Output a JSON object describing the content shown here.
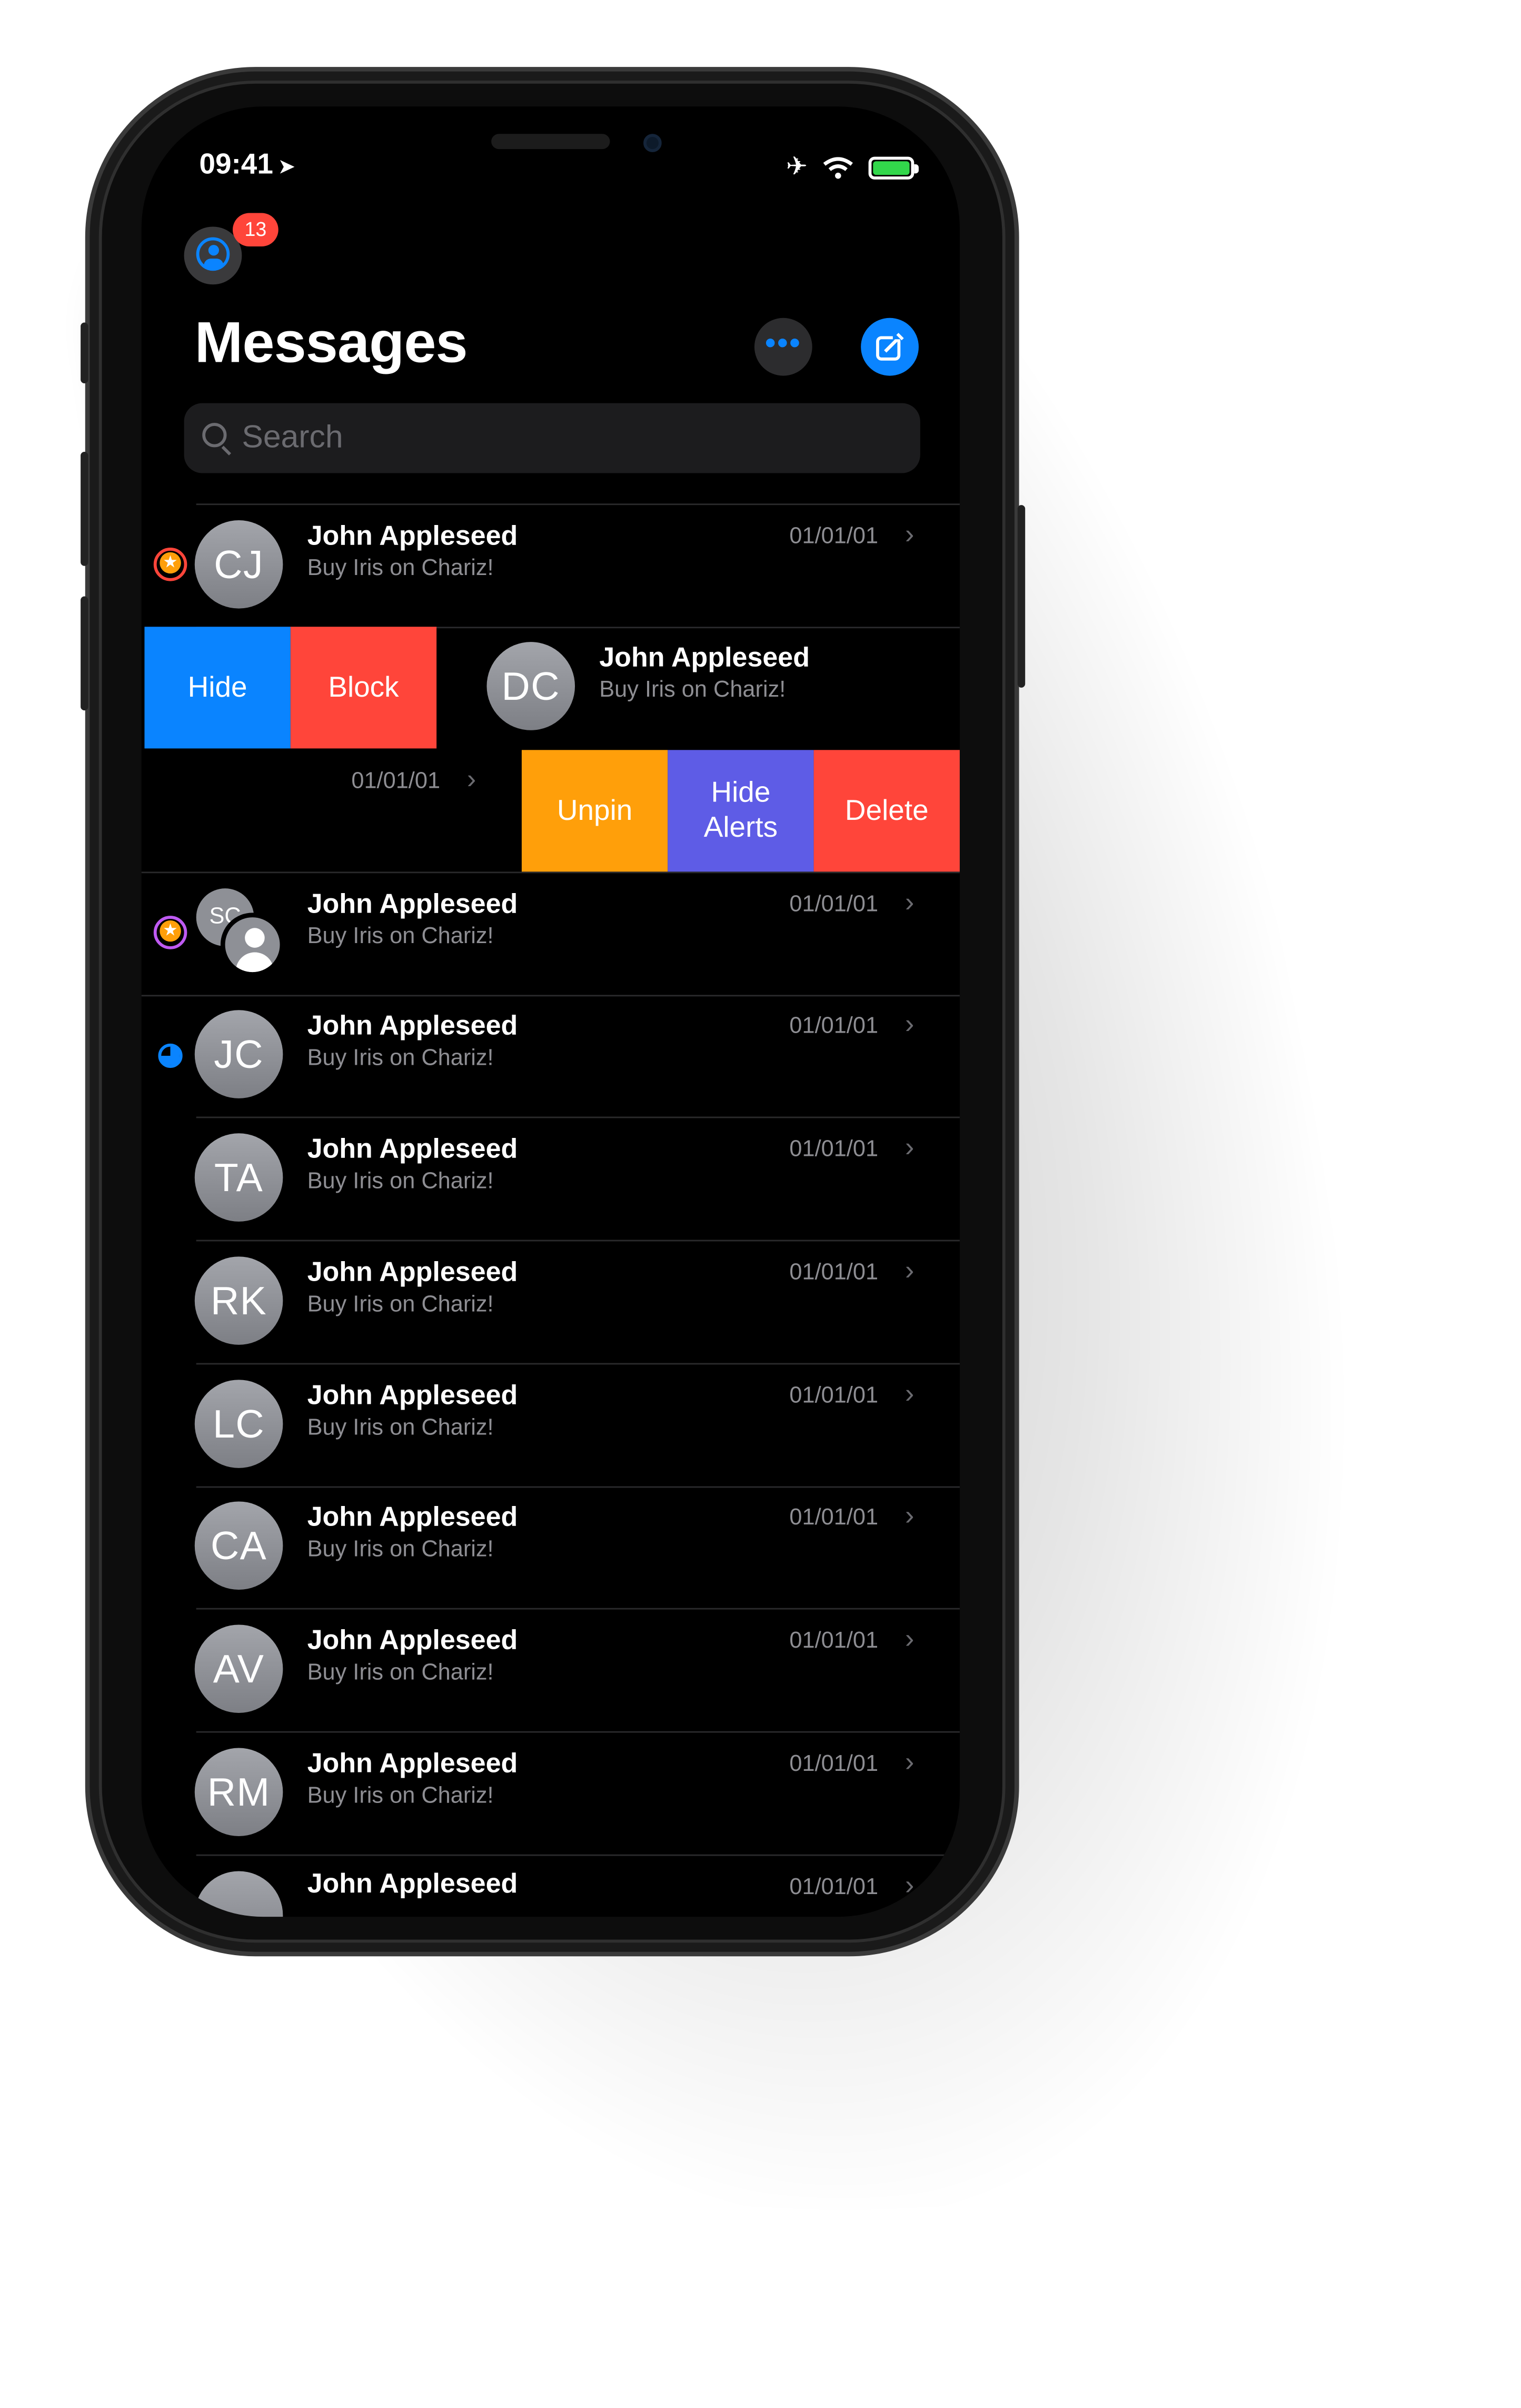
{
  "status_bar": {
    "time": "09:41",
    "location_arrow": "➤",
    "airplane_icon": "✈",
    "colors": {
      "battery": "#32d74b",
      "accent": "#0a84ff",
      "destructive": "#ff453a"
    }
  },
  "header": {
    "badge_count": "13",
    "title": "Messages",
    "more_label": "•••"
  },
  "search": {
    "placeholder": "Search"
  },
  "swipe_actions_left": [
    {
      "label": "Hide",
      "color": "#0a84ff"
    },
    {
      "label": "Block",
      "color": "#ff453a"
    }
  ],
  "swipe_actions_right": [
    {
      "label": "Unpin",
      "color": "#ff9f0a"
    },
    {
      "label": "Hide Alerts",
      "color": "#5e5ce6"
    },
    {
      "label": "Delete",
      "color": "#ff453a"
    }
  ],
  "conversations": [
    {
      "initials": "CJ",
      "name": "John Appleseed",
      "preview": "Buy Iris on Chariz!",
      "date": "01/01/01",
      "indicator": "pinned-red"
    },
    {
      "initials": "DC",
      "name": "John Appleseed",
      "preview": "Buy Iris on Chariz!",
      "date": "01/01/01",
      "indicator": "swiped"
    },
    {
      "initials": "SC",
      "name": "John Appleseed",
      "preview": "Buy Iris on Chariz!",
      "date": "01/01/01",
      "indicator": "pinned-purple"
    },
    {
      "initials": "JC",
      "name": "John Appleseed",
      "preview": "Buy Iris on Chariz!",
      "date": "01/01/01",
      "indicator": "unread"
    },
    {
      "initials": "TA",
      "name": "John Appleseed",
      "preview": "Buy Iris on Chariz!",
      "date": "01/01/01",
      "indicator": ""
    },
    {
      "initials": "RK",
      "name": "John Appleseed",
      "preview": "Buy Iris on Chariz!",
      "date": "01/01/01",
      "indicator": ""
    },
    {
      "initials": "LC",
      "name": "John Appleseed",
      "preview": "Buy Iris on Chariz!",
      "date": "01/01/01",
      "indicator": ""
    },
    {
      "initials": "CA",
      "name": "John Appleseed",
      "preview": "Buy Iris on Chariz!",
      "date": "01/01/01",
      "indicator": ""
    },
    {
      "initials": "AV",
      "name": "John Appleseed",
      "preview": "Buy Iris on Chariz!",
      "date": "01/01/01",
      "indicator": ""
    },
    {
      "initials": "RM",
      "name": "John Appleseed",
      "preview": "Buy Iris on Chariz!",
      "date": "01/01/01",
      "indicator": ""
    },
    {
      "initials": "",
      "name": "John Appleseed",
      "preview": "",
      "date": "01/01/01",
      "indicator": ""
    }
  ],
  "chevron": "›",
  "star_glyph": "★"
}
